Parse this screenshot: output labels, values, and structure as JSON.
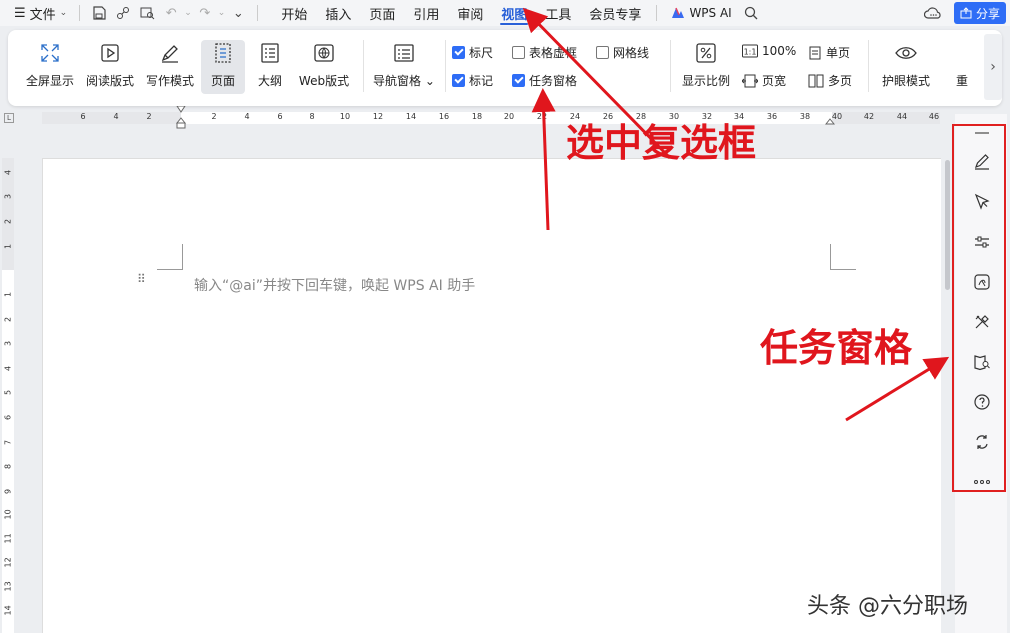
{
  "menubar": {
    "file_label": "文件",
    "tabs": [
      "开始",
      "插入",
      "页面",
      "引用",
      "审阅",
      "视图",
      "工具",
      "会员专享"
    ],
    "active_tab": "视图",
    "wps_ai_label": "WPS AI",
    "share_label": "分享"
  },
  "ribbon": {
    "fullscreen": "全屏显示",
    "reading": "阅读版式",
    "writing": "写作模式",
    "page": "页面",
    "outline": "大纲",
    "web": "Web版式",
    "nav_pane": "导航窗格",
    "ruler": "标尺",
    "table_grid": "表格虚框",
    "gridlines": "网格线",
    "marks": "标记",
    "task_pane": "任务窗格",
    "zoom": "显示比例",
    "zoom_100": "100%",
    "page_width": "页宽",
    "single_page": "单页",
    "multi_page": "多页",
    "eye_mode": "护眼模式",
    "rearrange": "重"
  },
  "checkboxes": {
    "ruler": true,
    "table_grid": false,
    "gridlines": false,
    "marks": true,
    "task_pane": true
  },
  "ruler": {
    "h_numbers": [
      "6",
      "4",
      "2",
      "2",
      "4",
      "6",
      "8",
      "10",
      "12",
      "14",
      "16",
      "18",
      "20",
      "22",
      "24",
      "26",
      "28",
      "30",
      "32",
      "34",
      "36",
      "38",
      "40",
      "42",
      "44",
      "46"
    ],
    "v_numbers": [
      "4",
      "3",
      "2",
      "1",
      "1",
      "2",
      "3",
      "4",
      "5",
      "6",
      "7",
      "8",
      "9",
      "10",
      "11",
      "12",
      "13",
      "14"
    ],
    "corner": "L"
  },
  "document": {
    "ai_hint": "输入“@ai”并按下回车键，唤起 WPS AI 助手"
  },
  "annotations": {
    "select_checkbox": "选中复选框",
    "task_pane": "任务窗格"
  },
  "watermark": "头条 @六分职场",
  "colors": {
    "accent": "#2860d8",
    "annotation_red": "#e0161d",
    "share_blue": "#2e6df6"
  }
}
